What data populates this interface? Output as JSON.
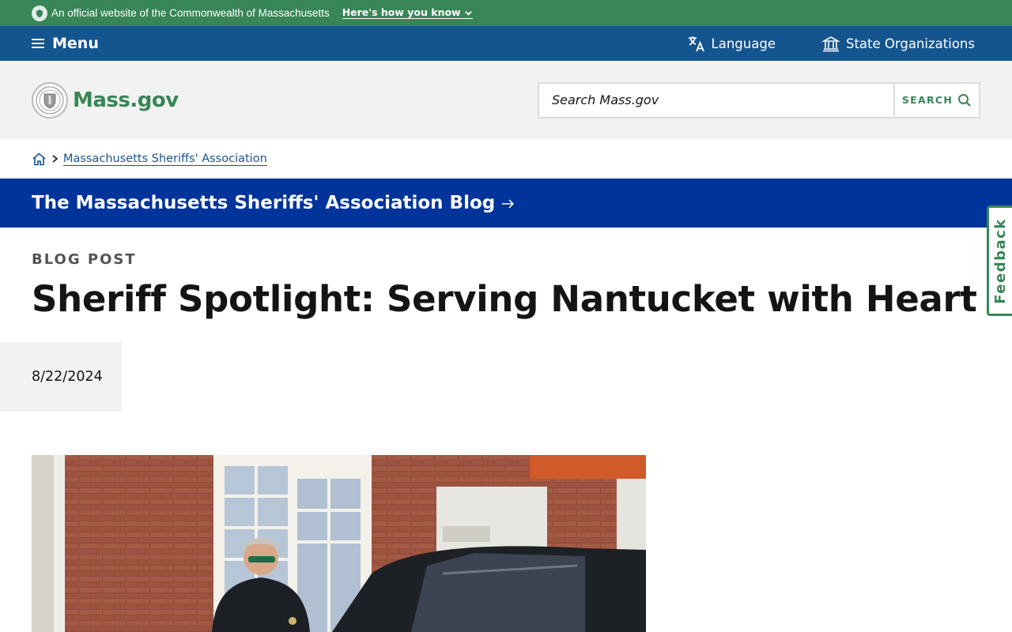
{
  "official_banner": {
    "text": "An official website of the Commonwealth of Massachusetts",
    "how_link": "Here's how you know"
  },
  "utility_nav": {
    "menu_label": "Menu",
    "language_label": "Language",
    "state_orgs_label": "State Organizations"
  },
  "header": {
    "logo_text": "Mass.gov",
    "search_placeholder": "Search Mass.gov",
    "search_button": "SEARCH"
  },
  "breadcrumb": {
    "items": [
      "Massachusetts Sheriffs' Association"
    ]
  },
  "blog_banner": {
    "title": "The Massachusetts Sheriffs' Association Blog"
  },
  "article": {
    "eyebrow": "BLOG POST",
    "title": "Sheriff Spotlight: Serving Nantucket with Heart",
    "date": "8/22/2024"
  },
  "feedback": {
    "label": "Feedback"
  },
  "colors": {
    "official_green": "#388557",
    "nav_blue": "#14558f",
    "banner_blue": "#00349b",
    "header_gray": "#f2f2f2"
  },
  "icons": {
    "seal": "massachusetts-seal-icon",
    "menu": "hamburger-icon",
    "language": "translate-icon",
    "state_orgs": "building-icon",
    "search": "search-icon",
    "home": "home-icon",
    "chevron": "chevron-right-icon",
    "arrow": "arrow-right-icon"
  }
}
